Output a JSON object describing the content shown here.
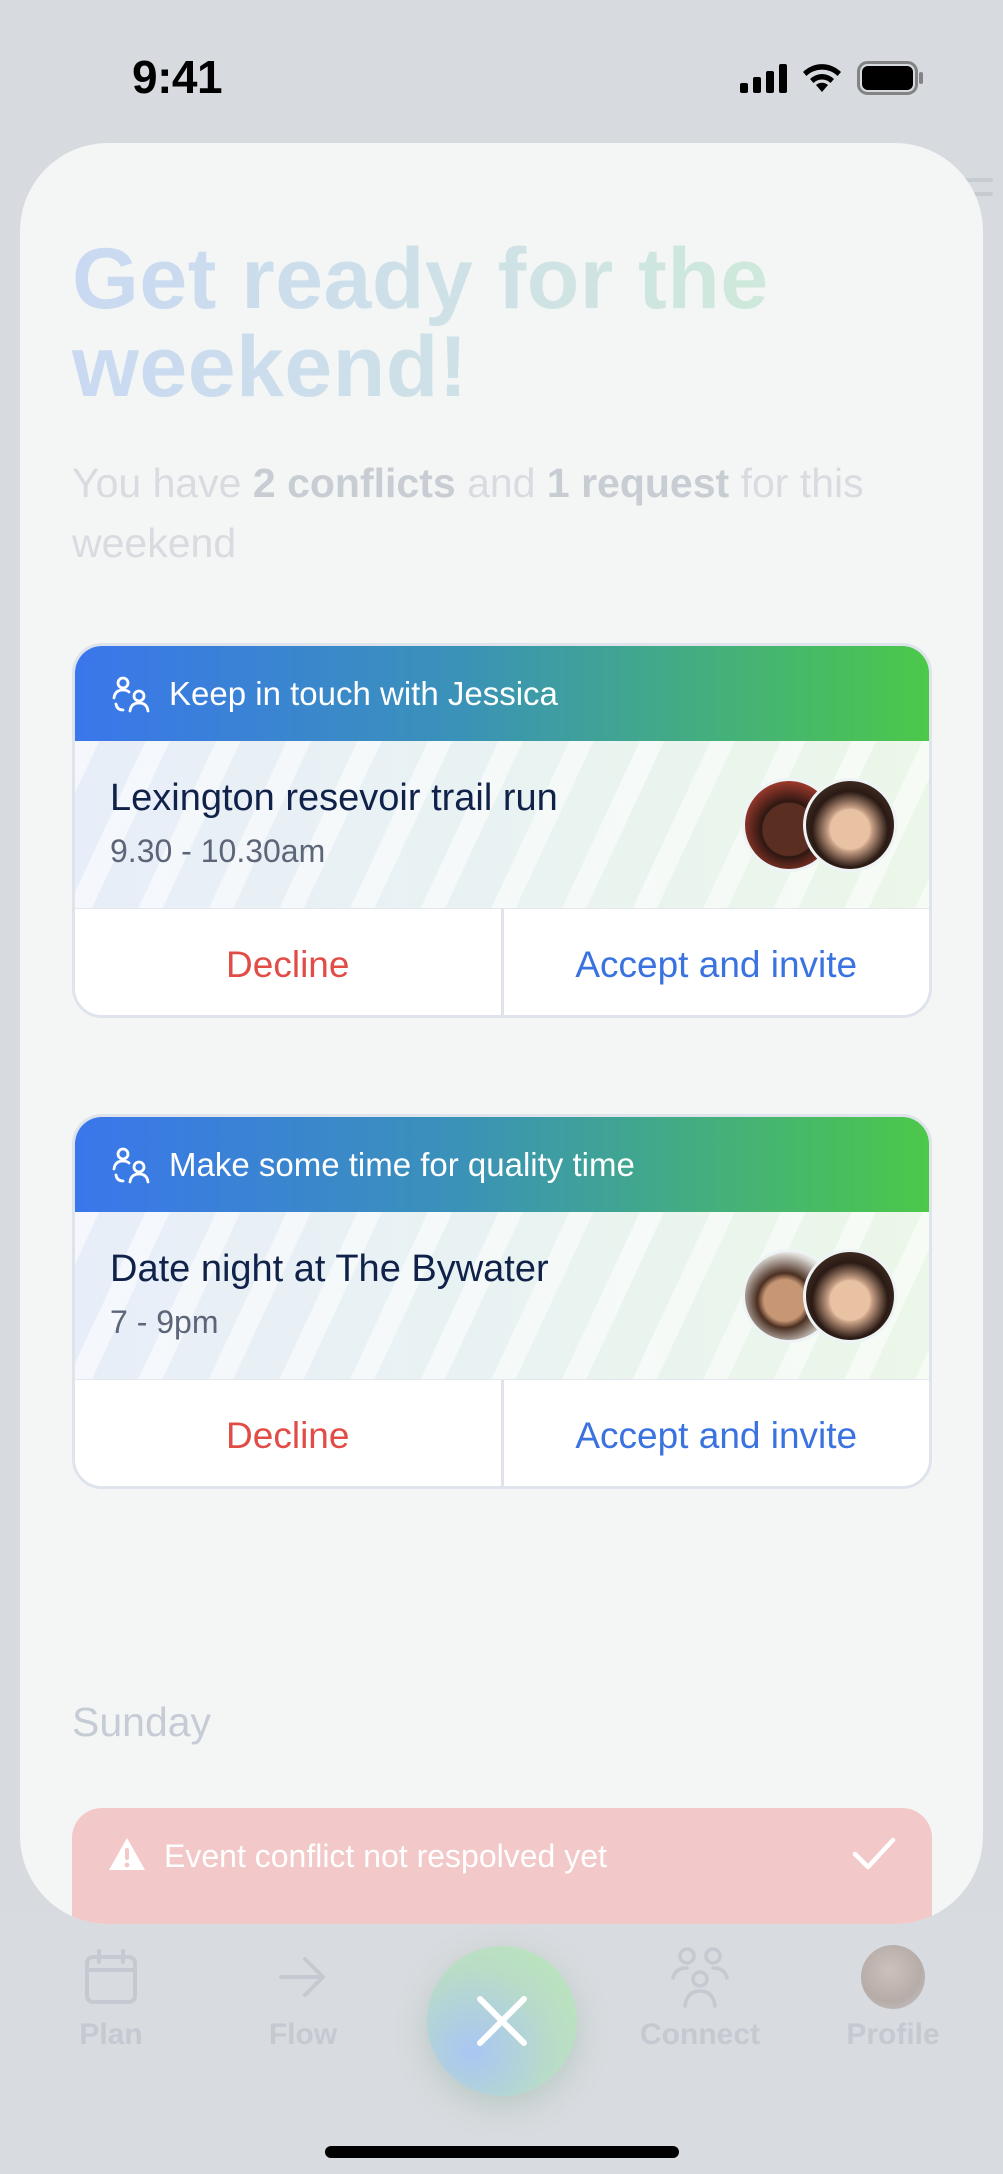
{
  "status_bar": {
    "time": "9:41"
  },
  "sheet": {
    "headline": "Get ready for the weekend!",
    "subtitle": {
      "prefix": "You have ",
      "conflicts": "2 conflicts",
      "middle": " and ",
      "requests": "1 request",
      "suffix": " for this weekend"
    },
    "cards": [
      {
        "header": "Keep in touch with Jessica",
        "title": "Lexington resevoir trail run",
        "time": "9.30 - 10.30am",
        "decline_label": "Decline",
        "accept_label": "Accept and invite"
      },
      {
        "header": "Make some time for quality time",
        "title": "Date night at The Bywater",
        "time": "7 - 9pm",
        "decline_label": "Decline",
        "accept_label": "Accept and invite"
      }
    ],
    "day_label": "Sunday",
    "conflict_banner": {
      "text": "Event conflict not respolved yet"
    }
  },
  "tab_bar": {
    "items": [
      {
        "label": "Plan",
        "icon": "calendar-icon"
      },
      {
        "label": "Flow",
        "icon": "arrow-right-icon"
      },
      {
        "label": "Connect",
        "icon": "people-icon"
      },
      {
        "label": "Profile",
        "icon": "avatar"
      }
    ]
  },
  "colors": {
    "accent_blue": "#3a72e0",
    "decline_red": "#e14d46",
    "gradient_start": "#3a76ec",
    "gradient_end": "#4cc84a",
    "conflict_bg": "#f2c9c8"
  }
}
